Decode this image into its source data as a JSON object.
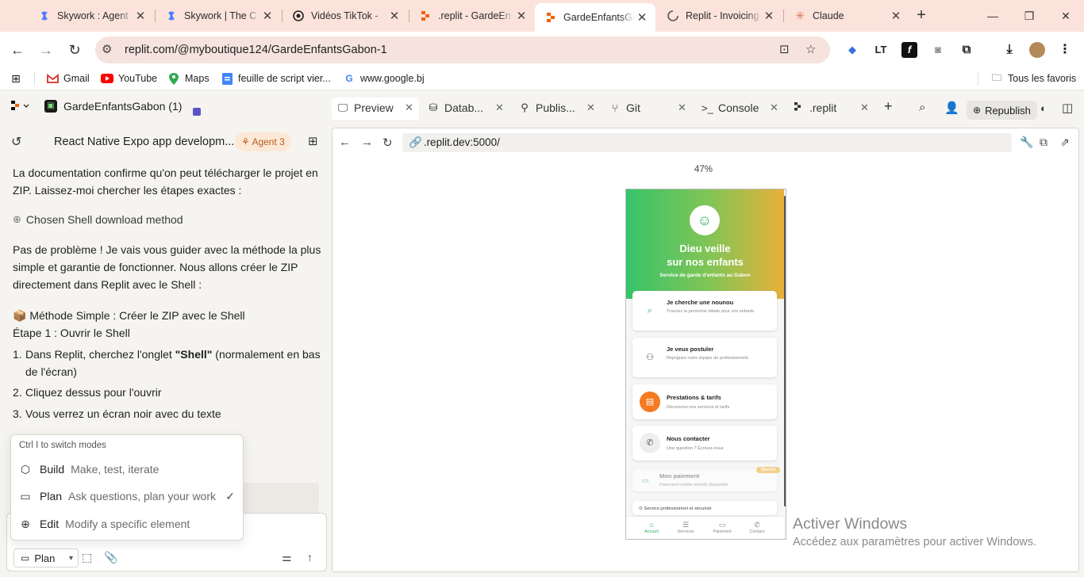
{
  "browser": {
    "tabs": [
      {
        "title": "Skywork : Agent",
        "icon": "skywork-icon"
      },
      {
        "title": "Skywork | The C",
        "icon": "skywork-icon"
      },
      {
        "title": "Vidéos TikTok - ",
        "icon": "tiktok-icon"
      },
      {
        "title": ".replit - GardeEn",
        "icon": "replit-icon"
      },
      {
        "title": "GardeEnfantsGab",
        "icon": "replit-icon",
        "active": true
      },
      {
        "title": "Replit - Invoicing",
        "icon": "loading-icon"
      },
      {
        "title": "Claude",
        "icon": "claude-icon"
      }
    ],
    "url": "replit.com/@myboutique124/GardeEnfantsGabon-1",
    "bookmarks": [
      {
        "label": "Gmail",
        "icon": "gmail-icon"
      },
      {
        "label": "YouTube",
        "icon": "youtube-icon"
      },
      {
        "label": "Maps",
        "icon": "maps-icon"
      },
      {
        "label": "feuille de script vier...",
        "icon": "sheets-icon"
      },
      {
        "label": "www.google.bj",
        "icon": "google-icon"
      }
    ],
    "all_bookmarks": "Tous les favoris"
  },
  "workspace": {
    "project_name": "GardeEnfantsGabon (1)",
    "tabs": [
      {
        "label": "Preview",
        "icon": "monitor-icon"
      },
      {
        "label": "Datab...",
        "icon": "database-icon"
      },
      {
        "label": "Publis...",
        "icon": "publish-icon"
      },
      {
        "label": "Git",
        "icon": "git-icon"
      },
      {
        "label": "Console",
        "icon": "console-icon"
      },
      {
        "label": ".replit",
        "icon": "replit-file-icon"
      }
    ],
    "republish": "Republish"
  },
  "agent": {
    "title": "React Native Expo app developm...",
    "badge": "Agent 3",
    "messages": {
      "m1": "La documentation confirme qu'on peut télécharger le projet en ZIP. Laissez-moi chercher les étapes exactes :",
      "chosen": "Chosen Shell download method",
      "m2": "Pas de problème ! Je vais vous guider avec la méthode la plus simple et garantie de fonctionner. Nous allons créer le ZIP directement dans Replit avec le Shell :",
      "method": "📦 Méthode Simple : Créer le ZIP avec le Shell",
      "step": "Étape 1 : Ouvrir le Shell",
      "list": [
        {
          "num": "1.",
          "pre": "Dans Replit, cherchez l'onglet ",
          "bold": "\"Shell\"",
          "post": " (normalement en bas de l'écran)"
        },
        {
          "num": "2.",
          "pre": "Cliquez dessus pour l'ouvrir",
          "bold": "",
          "post": ""
        },
        {
          "num": "3.",
          "pre": "Vous verrez un écran noir avec du texte",
          "bold": "",
          "post": ""
        }
      ]
    },
    "mode_menu": {
      "hint": "Ctrl I  to switch modes",
      "modes": [
        {
          "name": "Build",
          "desc": "Make, test, iterate",
          "icon": "cube-icon"
        },
        {
          "name": "Plan",
          "desc": "Ask questions, plan your work",
          "icon": "chat-icon",
          "checked": true
        },
        {
          "name": "Edit",
          "desc": "Modify a specific element",
          "icon": "target-icon"
        }
      ]
    },
    "mode_button": "Plan"
  },
  "preview": {
    "url": ".replit.dev:5000/",
    "zoom": "47%",
    "app": {
      "title_line1": "Dieu veille",
      "title_line2": "sur nos enfants",
      "subtitle": "Service de garde d'enfants au Gabon",
      "cards": [
        {
          "title": "Je cherche une nounou",
          "desc": "Trouvez la personne idéale pour vos enfants",
          "icon": "search-icon",
          "color": "#e6f6ec",
          "fg": "#2fae5e"
        },
        {
          "title": "Je veux postuler",
          "desc": "Rejoignez notre équipe de professionnels",
          "icon": "user-plus-icon",
          "color": "#f0f0f0",
          "fg": "#555555"
        },
        {
          "title": "Prestations & tarifs",
          "desc": "Découvrez nos services et tarifs",
          "icon": "clipboard-icon",
          "color": "#f47a1f",
          "fg": "#ffffff"
        },
        {
          "title": "Nous contacter",
          "desc": "Une question ? Écrivez-nous",
          "icon": "phone-icon",
          "color": "#eeeeee",
          "fg": "#555555"
        },
        {
          "title": "Mon paiement",
          "desc": "Paiement mobile bientôt disponible",
          "icon": "card-icon",
          "color": "#ffffff",
          "fg": "#2fae5e",
          "badge": "Bientôt"
        }
      ],
      "footer": "Service professionnel et sécurisé",
      "nav": [
        "Accueil",
        "Services",
        "Paiement",
        "Contact"
      ]
    }
  },
  "windows": {
    "line1": "Activer Windows",
    "line2": "Accédez aux paramètres pour activer Windows."
  },
  "colors": {
    "tabstrip": "#fbe3dc",
    "accent_green": "#2fae5e",
    "accent_orange": "#f47a1f",
    "agent_badge": "#fde8d7"
  }
}
